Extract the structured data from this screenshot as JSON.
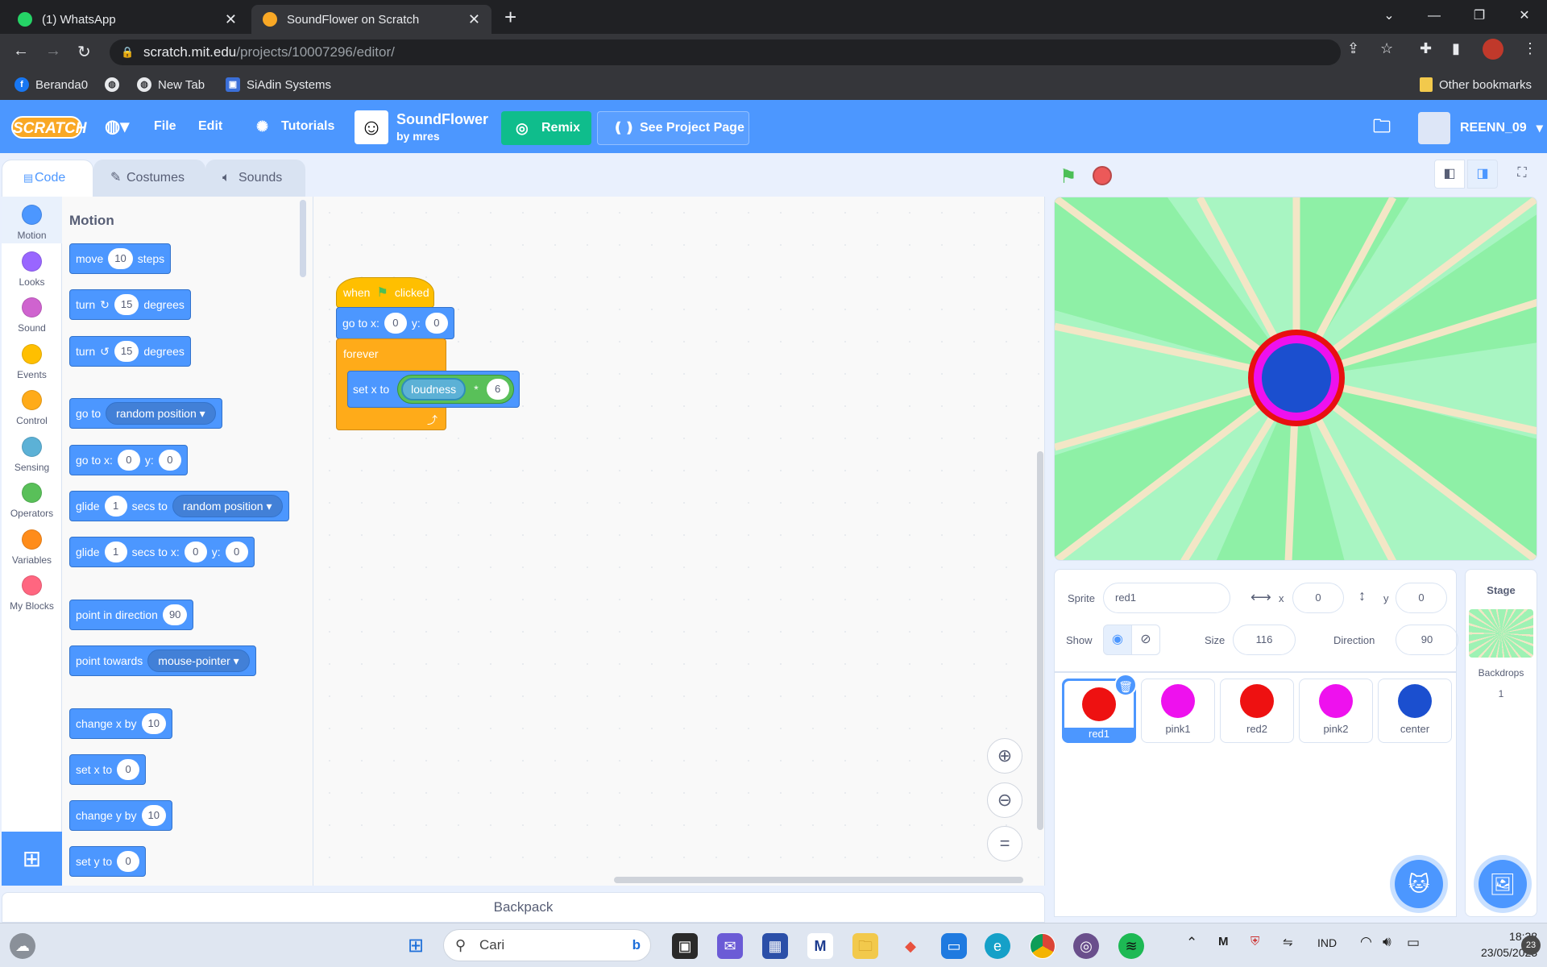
{
  "browser": {
    "tabs": [
      {
        "title": "(1) WhatsApp",
        "icon": "whatsapp-icon"
      },
      {
        "title": "SoundFlower on Scratch",
        "icon": "scratch-icon"
      }
    ],
    "url_domain": "scratch.mit.edu",
    "url_path": "/projects/10007296/editor/",
    "bookmarks": [
      {
        "label": "Beranda0",
        "icon": "facebook-icon"
      },
      {
        "label": "",
        "icon": "globe-icon"
      },
      {
        "label": "New Tab",
        "icon": "globe-icon"
      },
      {
        "label": "SiAdin Systems",
        "icon": "siadin-icon"
      }
    ],
    "other_bookmarks": "Other bookmarks"
  },
  "menu": {
    "logo": "SCRATCH",
    "file": "File",
    "edit": "Edit",
    "tutorials": "Tutorials",
    "project_title": "SoundFlower",
    "project_author": "by mres",
    "remix": "Remix",
    "see_project_page": "See Project Page",
    "username": "REENN_09"
  },
  "editor_tabs": [
    "Code",
    "Costumes",
    "Sounds"
  ],
  "categories": [
    {
      "label": "Motion",
      "color": "#4c97ff"
    },
    {
      "label": "Looks",
      "color": "#9966ff"
    },
    {
      "label": "Sound",
      "color": "#cf63cf"
    },
    {
      "label": "Events",
      "color": "#ffbf00"
    },
    {
      "label": "Control",
      "color": "#ffab19"
    },
    {
      "label": "Sensing",
      "color": "#5cb1d6"
    },
    {
      "label": "Operators",
      "color": "#59c059"
    },
    {
      "label": "Variables",
      "color": "#ff8c1a"
    },
    {
      "label": "My Blocks",
      "color": "#ff6680"
    }
  ],
  "palette": {
    "heading": "Motion",
    "move": {
      "a": "move",
      "v": "10",
      "b": "steps"
    },
    "turn_right": {
      "a": "turn",
      "v": "15",
      "b": "degrees"
    },
    "turn_left": {
      "a": "turn",
      "v": "15",
      "b": "degrees"
    },
    "go_to": {
      "a": "go to",
      "dd": "random position"
    },
    "go_to_xy": {
      "a": "go to x:",
      "x": "0",
      "b": "y:",
      "y": "0"
    },
    "glide_to": {
      "a": "glide",
      "v": "1",
      "b": "secs to",
      "dd": "random position"
    },
    "glide_xy": {
      "a": "glide",
      "v": "1",
      "b": "secs to x:",
      "x": "0",
      "c": "y:",
      "y": "0"
    },
    "point_dir": {
      "a": "point in direction",
      "v": "90"
    },
    "point_towards": {
      "a": "point towards",
      "dd": "mouse-pointer"
    },
    "change_x": {
      "a": "change x by",
      "v": "10"
    },
    "set_x": {
      "a": "set x to",
      "v": "0"
    },
    "change_y": {
      "a": "change y by",
      "v": "10"
    },
    "set_y": {
      "a": "set y to",
      "v": "0"
    }
  },
  "script": {
    "when": "when",
    "clicked": "clicked",
    "goto_a": "go to x:",
    "goto_x": "0",
    "goto_b": "y:",
    "goto_y": "0",
    "forever": "forever",
    "setx": "set x to",
    "loudness": "loudness",
    "times": "*",
    "factor": "6"
  },
  "backpack": "Backpack",
  "sprite_info": {
    "sprite_label": "Sprite",
    "sprite_name": "red1",
    "x_label": "x",
    "x": "0",
    "y_label": "y",
    "y": "0",
    "show_label": "Show",
    "size_label": "Size",
    "size": "116",
    "direction_label": "Direction",
    "direction": "90"
  },
  "sprites": [
    {
      "name": "red1",
      "color": "#ee1111"
    },
    {
      "name": "pink1",
      "color": "#ee11ee"
    },
    {
      "name": "red2",
      "color": "#ee1111"
    },
    {
      "name": "pink2",
      "color": "#ee11ee"
    },
    {
      "name": "center",
      "color": "#1b4fcf"
    }
  ],
  "stage_pane": {
    "title": "Stage",
    "backdrops_label": "Backdrops",
    "backdrops_count": "1"
  },
  "taskbar": {
    "search_placeholder": "Cari",
    "lang": "IND",
    "time": "18:38",
    "date": "23/05/2023",
    "notif": "23"
  }
}
